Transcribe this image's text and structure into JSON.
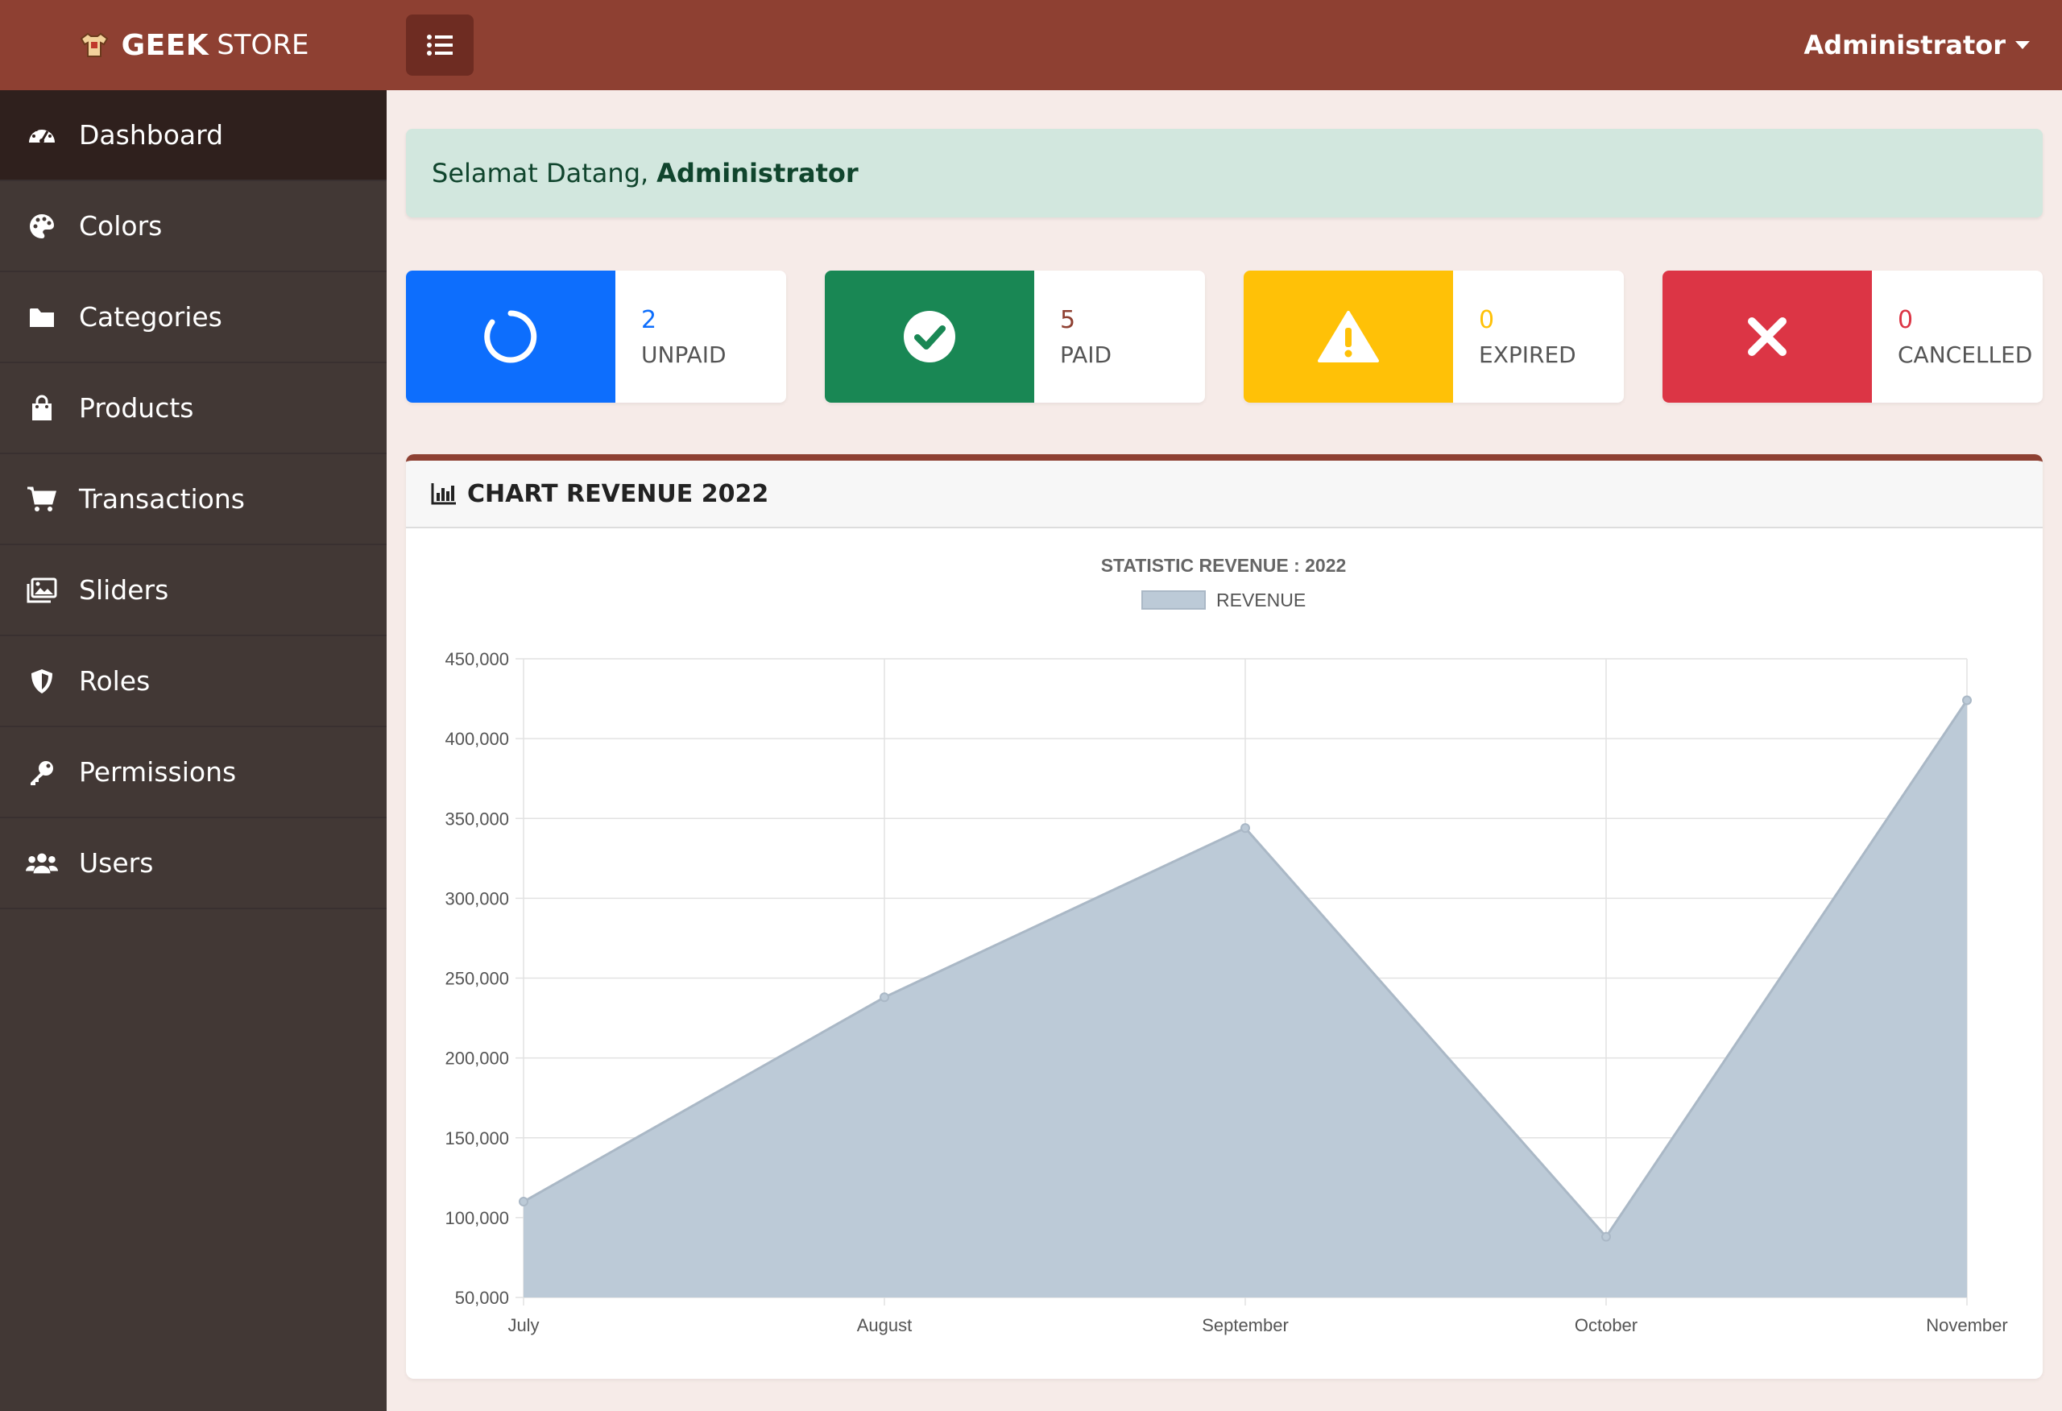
{
  "brand": {
    "bold": "GEEK",
    "light": "STORE"
  },
  "user": {
    "name": "Administrator"
  },
  "sidebar": {
    "items": [
      {
        "label": "Dashboard",
        "icon": "gauge-icon"
      },
      {
        "label": "Colors",
        "icon": "palette-icon"
      },
      {
        "label": "Categories",
        "icon": "folder-icon"
      },
      {
        "label": "Products",
        "icon": "shopping-bag-icon"
      },
      {
        "label": "Transactions",
        "icon": "cart-icon"
      },
      {
        "label": "Sliders",
        "icon": "images-icon"
      },
      {
        "label": "Roles",
        "icon": "shield-icon"
      },
      {
        "label": "Permissions",
        "icon": "key-icon"
      },
      {
        "label": "Users",
        "icon": "users-icon"
      }
    ]
  },
  "welcome": {
    "prefix": "Selamat Datang,",
    "name": "Administrator"
  },
  "stats": [
    {
      "value": "2",
      "label": "UNPAID",
      "color": "#0d6efd",
      "icon": "spinner-icon"
    },
    {
      "value": "5",
      "label": "PAID",
      "color": "#198754",
      "icon": "check-circle-icon"
    },
    {
      "value": "0",
      "label": "EXPIRED",
      "color": "#ffc107",
      "icon": "warning-icon"
    },
    {
      "value": "0",
      "label": "CANCELLED",
      "color": "#dc3545",
      "icon": "times-icon"
    }
  ],
  "card": {
    "title": "CHART REVENUE 2022"
  },
  "colors": {
    "topbar": "#8e4032",
    "sidebar": "#423835",
    "sidebar_active": "#2f201d",
    "area_fill": "#bccad7",
    "area_line": "#aab8c6"
  },
  "chart_data": {
    "type": "area",
    "title": "STATISTIC REVENUE : 2022",
    "categories": [
      "July",
      "August",
      "September",
      "October",
      "November"
    ],
    "series": [
      {
        "name": "REVENUE",
        "values": [
          110000,
          238000,
          344000,
          88000,
          424000
        ]
      }
    ],
    "ylim": [
      50000,
      450000
    ],
    "yticks": [
      "450,000",
      "400,000",
      "350,000",
      "300,000",
      "250,000",
      "200,000",
      "150,000",
      "100,000",
      "50,000"
    ],
    "grid": true,
    "legend": "top-center"
  }
}
